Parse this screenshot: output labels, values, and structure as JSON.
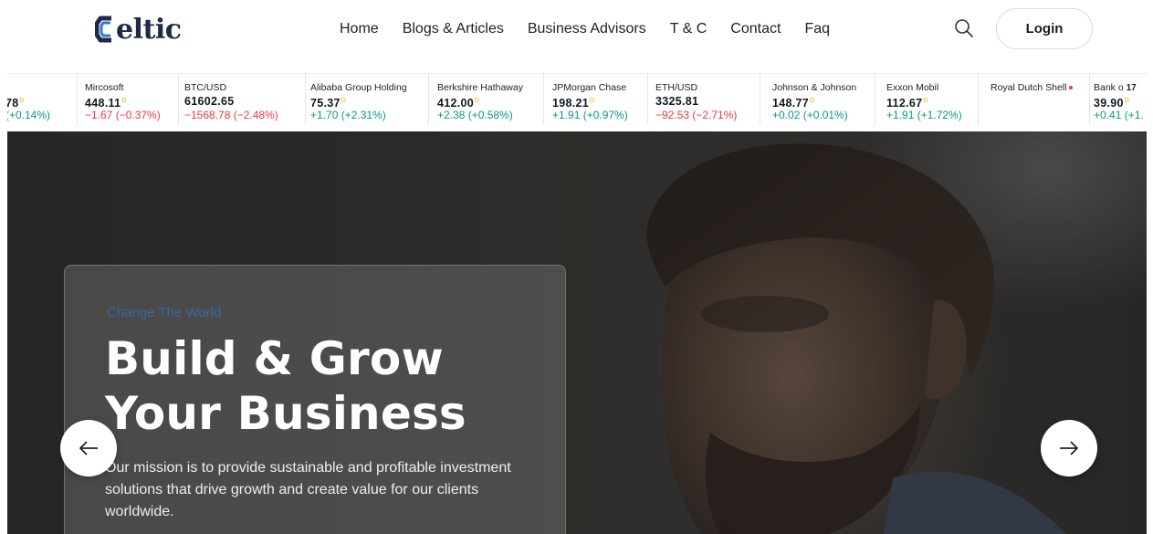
{
  "brand": {
    "logo_text": "eltic"
  },
  "nav": {
    "items": [
      {
        "label": "Home"
      },
      {
        "label": "Blogs & Articles"
      },
      {
        "label": "Business Advisors"
      },
      {
        "label": "T & C"
      },
      {
        "label": "Contact"
      },
      {
        "label": "Faq"
      }
    ]
  },
  "header": {
    "search_icon": "search-icon",
    "login_label": "Login"
  },
  "ticker": {
    "items": [
      {
        "name": "",
        "price": "78",
        "change": "(+0.14%)",
        "trend": "up"
      },
      {
        "name": "Mircosoft",
        "price": "448.11",
        "change": "−1.67 (−0.37%)",
        "trend": "down"
      },
      {
        "name": "BTC/USD",
        "price": "61602.65",
        "change": "−1568.78 (−2.48%)",
        "trend": "down"
      },
      {
        "name": "Alibaba Group Holding",
        "price": "75.37",
        "change": "+1.70 (+2.31%)",
        "trend": "up"
      },
      {
        "name": "Berkshire Hathaway",
        "price": "412.00",
        "change": "+2.38 (+0.58%)",
        "trend": "up"
      },
      {
        "name": "JPMorgan Chase",
        "price": "198.21",
        "change": "+1.91 (+0.97%)",
        "trend": "up"
      },
      {
        "name": "ETH/USD",
        "price": "3325.81",
        "change": "−92.53 (−2.71%)",
        "trend": "down"
      },
      {
        "name": "Johnson & Johnson",
        "price": "148.77",
        "change": "+0.02 (+0.01%)",
        "trend": "up"
      },
      {
        "name": "Exxon Mobil",
        "price": "112.67",
        "change": "+1.91 (+1.72%)",
        "trend": "up"
      },
      {
        "name": "Royal Dutch Shell",
        "price": "",
        "change": "",
        "trend": "down"
      },
      {
        "name": "Bank o",
        "price": "39.90",
        "change": "+0.41 (+1.",
        "trend": "up"
      }
    ],
    "currency_mark": "D"
  },
  "hero": {
    "eyebrow": "Change The World",
    "title": "Build & Grow Your Business",
    "text": "Our mission is to provide sustainable and profitable investment solutions that drive growth and create value for our clients worldwide.",
    "prev_icon": "arrow-left-icon",
    "next_icon": "arrow-right-icon"
  },
  "colors": {
    "accent": "#3a66a8",
    "positive": "#089981",
    "negative": "#f23645",
    "brand_dark": "#1f2a44"
  }
}
